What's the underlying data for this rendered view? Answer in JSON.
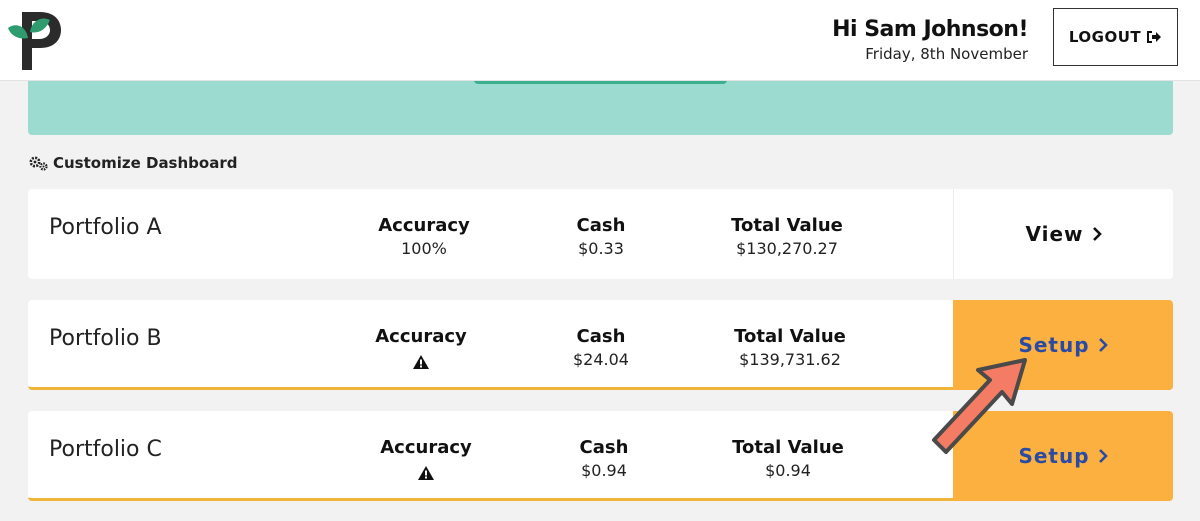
{
  "header": {
    "greeting": "Hi Sam Johnson!",
    "date": "Friday, 8th November",
    "logout_label": "LOGOUT",
    "logo_icon": "leaf-p-logo-icon",
    "colors": {
      "logo_dark": "#2b2b2b",
      "logo_green": "#2e9c6e"
    }
  },
  "banner": {
    "color": "#9cdbd0",
    "button_color": "#3bb08f"
  },
  "customize": {
    "label": "Customize Dashboard",
    "icon": "gears-icon"
  },
  "portfolios": [
    {
      "name": "Portfolio A",
      "accuracy_label": "Accuracy",
      "accuracy_value": "100%",
      "cash_label": "Cash",
      "cash_value": "$0.33",
      "total_label": "Total Value",
      "total_value": "$130,270.27",
      "action_label": "View"
    },
    {
      "name": "Portfolio B",
      "accuracy_label": "Accuracy",
      "accuracy_icon": "warning-icon",
      "cash_label": "Cash",
      "cash_value": "$24.04",
      "total_label": "Total Value",
      "total_value": "$139,731.62",
      "action_label": "Setup"
    },
    {
      "name": "Portfolio C",
      "accuracy_label": "Accuracy",
      "accuracy_icon": "warning-icon",
      "cash_label": "Cash",
      "cash_value": "$0.94",
      "total_label": "Total Value",
      "total_value": "$0.94",
      "action_label": "Setup"
    }
  ],
  "colors": {
    "setup_bg": "#fbb040",
    "setup_text": "#2a4ba3",
    "warn_border": "#f0b43a",
    "annotation_arrow": "#f47c64"
  }
}
